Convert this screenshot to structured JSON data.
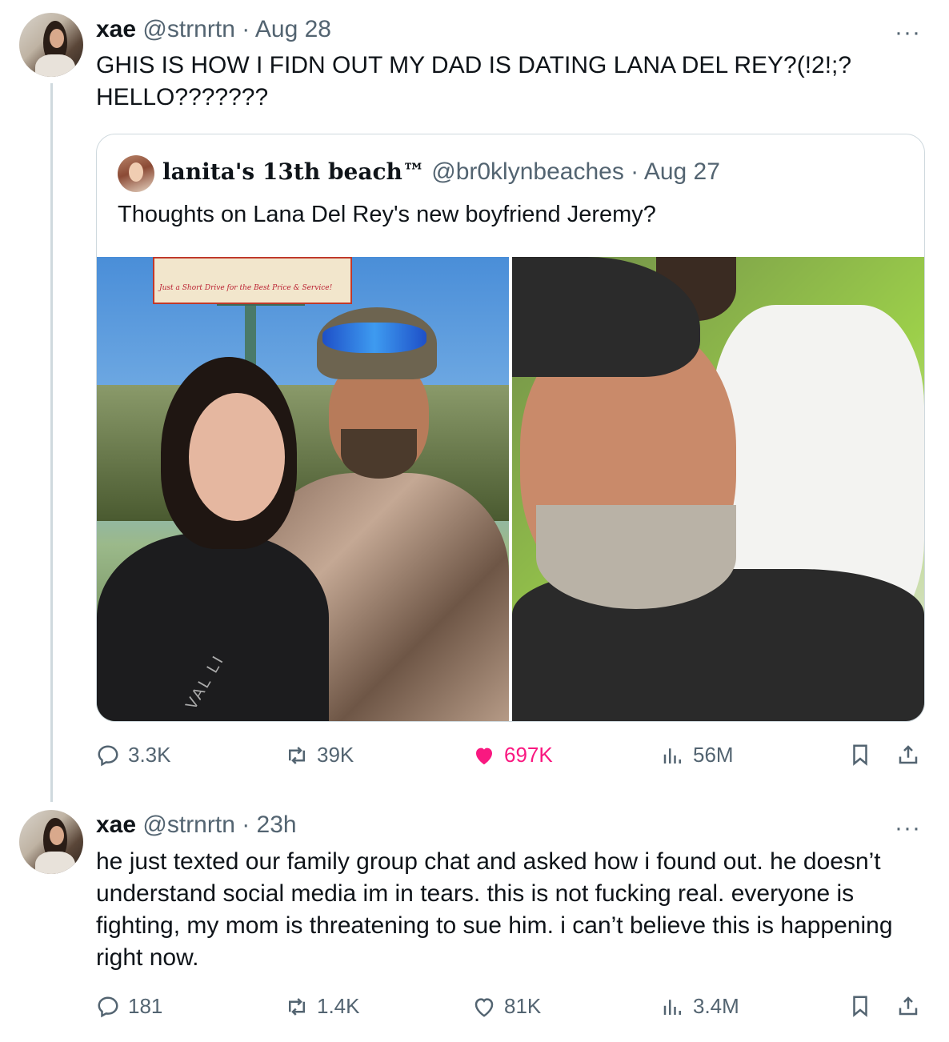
{
  "tweet1": {
    "name": "xae",
    "handle": "@strnrtn",
    "date": "· Aug 28",
    "text": "GHIS IS HOW I FIDN OUT MY DAD IS DATING LANA DEL REY?(!2!;?\nHELLO???????",
    "more": "···",
    "quote": {
      "name": "lanita's 13th beach™",
      "handle": "@br0klynbeaches",
      "date": "· Aug 27",
      "text": "Thoughts on Lana Del Rey's new boyfriend Jeremy?",
      "photo_left_billboard": "Just a Short Drive for the Best Price & Service!",
      "photo_left_strap": "VAL LI"
    },
    "stats": {
      "replies": "3.3K",
      "reposts": "39K",
      "likes": "697K",
      "views": "56M"
    }
  },
  "tweet2": {
    "name": "xae",
    "handle": "@strnrtn",
    "date": "· 23h",
    "more": "···",
    "text": "he just texted our family group chat and asked how i found out. he doesn’t\nunderstand social media im in tears. this is not fucking real. everyone is\nfighting, my mom is threatening to sue him. i can’t believe this is happening\nright now.",
    "stats": {
      "replies": "181",
      "reposts": "1.4K",
      "likes": "81K",
      "views": "3.4M"
    }
  },
  "colors": {
    "text": "#0f1419",
    "muted": "#536471",
    "like": "#f91880",
    "border": "#cfd9de"
  },
  "icons": [
    "reply-icon",
    "repost-icon",
    "like-icon",
    "views-icon",
    "bookmark-icon",
    "share-icon",
    "more-icon"
  ]
}
